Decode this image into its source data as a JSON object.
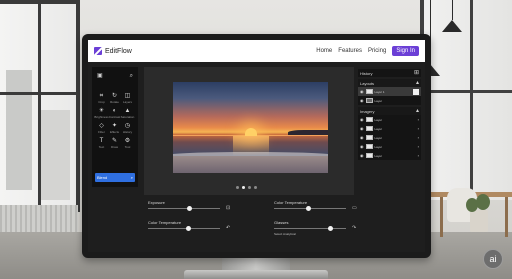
{
  "app": {
    "brand": "EditFlow",
    "nav": [
      {
        "label": "Home"
      },
      {
        "label": "Features"
      },
      {
        "label": "Pricing"
      }
    ],
    "signin_label": "Sign In"
  },
  "tools": {
    "items": [
      {
        "label": "Crop",
        "icon": "crop-icon"
      },
      {
        "label": "Rotate",
        "icon": "rotate-icon"
      },
      {
        "label": "Layers",
        "icon": "layers-icon"
      },
      {
        "label": "Brightness",
        "icon": "brightness-icon"
      },
      {
        "label": "Contrast",
        "icon": "contrast-icon"
      },
      {
        "label": "Saturation",
        "icon": "saturation-icon"
      },
      {
        "label": "Filter",
        "icon": "filter-icon"
      },
      {
        "label": "Effects",
        "icon": "effects-icon"
      },
      {
        "label": "History",
        "icon": "history-icon"
      },
      {
        "label": "Text",
        "icon": "text-icon"
      },
      {
        "label": "Draw",
        "icon": "draw-icon"
      },
      {
        "label": "Tool",
        "icon": "tool-icon"
      }
    ],
    "button_label": "Blend"
  },
  "canvas": {
    "pagination": {
      "count": 4,
      "active_index": 1
    }
  },
  "right_panel": {
    "history_title": "History",
    "layers": {
      "section": "Layouts",
      "items": [
        {
          "label": "Layer 1",
          "selected": true
        },
        {
          "label": "Layer"
        }
      ]
    },
    "imagery": {
      "section": "Imagery",
      "items": [
        {
          "label": "Layer"
        },
        {
          "label": "Layer"
        },
        {
          "label": "Layer"
        },
        {
          "label": "Layer"
        },
        {
          "label": "Layer"
        }
      ]
    }
  },
  "adjustments": {
    "exposure": {
      "label": "Exposure",
      "value": 0.58
    },
    "color_temperature_top": {
      "label": "Color Temperature",
      "value": 0.48
    },
    "color_temperature_left": {
      "label": "Color Temperature",
      "value": 0.56
    },
    "glasses": {
      "label": "Glasses",
      "value": 0.8,
      "sub_label": "Select Analytical"
    }
  },
  "watermark": "ai",
  "colors": {
    "accent": "#6b3fd6",
    "primary_button": "#2f6fe0",
    "panel_bg": "#1e1e1e"
  }
}
